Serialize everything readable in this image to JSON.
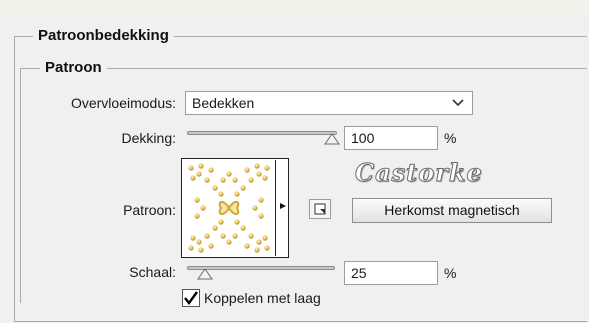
{
  "panel": {
    "section_title": "Patroonbedekking",
    "group_title": "Patroon"
  },
  "blend_mode": {
    "label": "Overvloeimodus:",
    "value": "Bedekken"
  },
  "opacity": {
    "label": "Dekking:",
    "value": "100",
    "unit": "%",
    "slider_fraction": 1.0
  },
  "pattern": {
    "label": "Patroon:",
    "snap_button_label": "Herkomst magnetisch",
    "watermark": "Castorke"
  },
  "scale": {
    "label": "Schaal:",
    "value": "25",
    "unit": "%",
    "slider_fraction": 0.12
  },
  "link": {
    "label": "Koppelen met laag",
    "checked": true
  },
  "icons": {
    "dropdown": "chevron-down-icon",
    "pattern_menu": "triangle-right-icon",
    "new_preset": "new-preset-icon",
    "checkmark": "checkmark-icon",
    "slider_thumb": "triangle-slider-thumb-icon"
  },
  "colors": {
    "background": "#f0f0f0",
    "pattern_gold": "#d9b24a"
  }
}
